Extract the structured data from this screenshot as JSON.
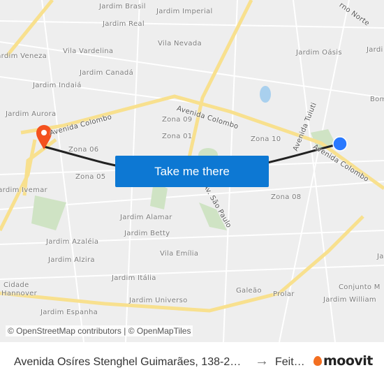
{
  "map": {
    "labels": [
      {
        "text": "Jardim Brasil"
      },
      {
        "text": "Jardim Imperial"
      },
      {
        "text": "Jardim Real"
      },
      {
        "text": "Vila Nevada"
      },
      {
        "text": "Vila Vardelina"
      },
      {
        "text": "Jardim Veneza"
      },
      {
        "text": "Jardim Canadá"
      },
      {
        "text": "Jardim Indaiá"
      },
      {
        "text": "Jardim Oásis"
      },
      {
        "text": "Jardi"
      },
      {
        "text": "Bom"
      },
      {
        "text": "Jardim Aurora"
      },
      {
        "text": "Zona 09"
      },
      {
        "text": "Zona 01"
      },
      {
        "text": "Zona 10"
      },
      {
        "text": "Zona 06"
      },
      {
        "text": "Zona 05"
      },
      {
        "text": "Zona 08"
      },
      {
        "text": "Jardim Ivemar"
      },
      {
        "text": "Jardim Alamar"
      },
      {
        "text": "Jardim Betty"
      },
      {
        "text": "Jardim Azaléia"
      },
      {
        "text": "Jardim Alzira"
      },
      {
        "text": "Vila Emília"
      },
      {
        "text": "Cidade"
      },
      {
        "text": "Hannover"
      },
      {
        "text": "Jardim Itália"
      },
      {
        "text": "Jardim Universo"
      },
      {
        "text": "Galeão"
      },
      {
        "text": "Prolar"
      },
      {
        "text": "Conjunto M"
      },
      {
        "text": "Jardim William"
      },
      {
        "text": "Jardim Espanha"
      },
      {
        "text": "Ja"
      }
    ],
    "roads": [
      {
        "text": "Avenida Colombo"
      },
      {
        "text": "Avenida Colombo"
      },
      {
        "text": "Avenida Colombo"
      },
      {
        "text": "Avenida Tuiuti"
      },
      {
        "text": "Av. São Paulo"
      },
      {
        "text": "rno Norte"
      }
    ],
    "origin_color": "#2979ff",
    "destination_color": "#f4511e"
  },
  "cta": {
    "label": "Take me there"
  },
  "attribution": "© OpenStreetMap contributors | © OpenMapTiles",
  "footer": {
    "from": "Avenida Osíres Stenghel Guimarães, 138-2…",
    "arrow": "→",
    "to": "Feit…",
    "brand": "moovit"
  }
}
